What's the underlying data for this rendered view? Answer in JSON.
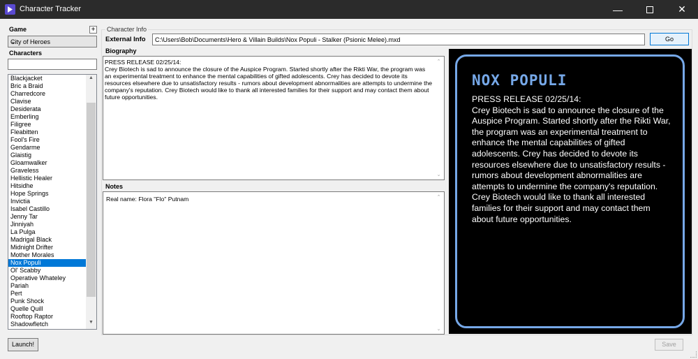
{
  "window": {
    "title": "Character Tracker"
  },
  "game": {
    "label": "Game",
    "add_label": "+",
    "selected": "City of Heroes"
  },
  "characters": {
    "label": "Characters",
    "search_value": "",
    "items": [
      "Blackjacket",
      "Bric a Braid",
      "Charredcore",
      "Clavise",
      "Desiderata",
      "Emberling",
      "Filigree",
      "Fleabitten",
      "Fool's Fire",
      "Gendarme",
      "Glaistig",
      "Gloamwalker",
      "Graveless",
      "Hellistic Healer",
      "Hitsidhe",
      "Hope Springs",
      "Invictia",
      "Isabel Castillo",
      "Jenny Tar",
      "Jinniyah",
      "La Pulga",
      "Madrigal Black",
      "Midnight Drifter",
      "Mother Morales",
      "Nox Populi",
      "Ol' Scabby",
      "Operative Whateley",
      "Pariah",
      "Pert",
      "Punk Shock",
      "Quelle Quill",
      "Rooftop Raptor",
      "Shadowfletch"
    ],
    "selected": "Nox Populi"
  },
  "launch_label": "Launch!",
  "info": {
    "group_title": "Character Info",
    "external_label": "External Info",
    "external_value": "C:\\Users\\Bob\\Documents\\Hero & Villain Builds\\Nox Populi - Stalker (Psionic Melee).mxd",
    "go_label": "Go",
    "bio_label": "Biography",
    "bio_line1": "PRESS RELEASE 02/25/14:",
    "bio_line2": "Crey Biotech is sad to announce the closure of the Auspice Program.  Started shortly after the Rikti War, the program was an experimental treatment to enhance the mental capabilities of gifted adolescents.  Crey has decided to devote its resources elsewhere due to unsatisfactory results - rumors about development abnormalities are attempts to undermine the company's reputation.  Crey Biotech would like to thank all interested families for their support and may contact them about future opportunities.",
    "notes_label": "Notes",
    "notes_text": "Real name: Flora \"Flo\" Putnam",
    "save_label": "Save"
  },
  "preview": {
    "name": "NOX POPULI",
    "line1": "PRESS RELEASE 02/25/14:",
    "line2": "Crey Biotech is sad to announce the closure of the Auspice Program. Started shortly after the Rikti War, the program was an experimental treatment to enhance the mental capabilities of gifted adolescents. Crey has decided to devote its resources elsewhere due to unsatisfactory results - rumors about development abnormalities are attempts to undermine the company's reputation. Crey Biotech would like to thank all interested families for their support and may contact them about future opportunities.",
    "accent_color": "#76a8e8"
  }
}
